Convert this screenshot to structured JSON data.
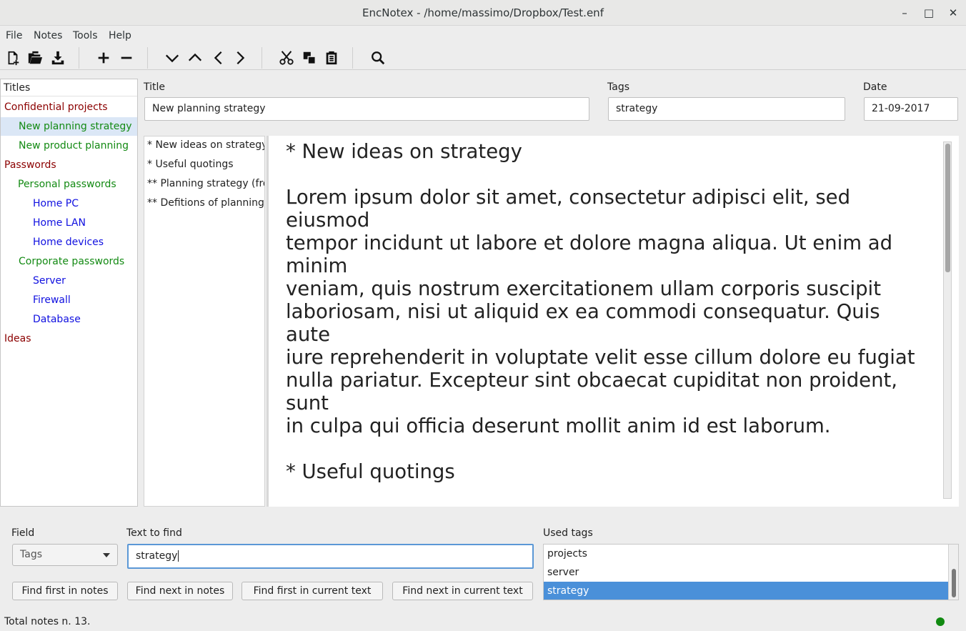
{
  "window": {
    "title": "EncNotex - /home/massimo/Dropbox/Test.enf",
    "minimize": "–",
    "maximize": "□",
    "close": "✕"
  },
  "menu": [
    "File",
    "Notes",
    "Tools",
    "Help"
  ],
  "toolbar": {
    "icons": [
      "new-file-icon",
      "open-file-icon",
      "save-file-icon",
      "add-icon",
      "remove-icon",
      "move-down-icon",
      "move-up-icon",
      "move-left-icon",
      "move-right-icon",
      "cut-icon",
      "copy-icon",
      "paste-icon",
      "search-icon"
    ]
  },
  "tree": {
    "header": "Titles",
    "items": [
      {
        "label": "Confidential projects",
        "level": 0,
        "color": "#8b0000"
      },
      {
        "label": "New planning strategy",
        "level": 1,
        "color": "#138a13",
        "selected": true
      },
      {
        "label": "New product planning",
        "level": 1,
        "color": "#138a13"
      },
      {
        "label": "Passwords",
        "level": 0,
        "color": "#8b0000"
      },
      {
        "label": "Personal passwords",
        "level": 1,
        "color": "#138a13"
      },
      {
        "label": "Home PC",
        "level": 2,
        "color": "#1010e0"
      },
      {
        "label": "Home LAN",
        "level": 2,
        "color": "#1010e0"
      },
      {
        "label": "Home devices",
        "level": 2,
        "color": "#1010e0"
      },
      {
        "label": "Corporate passwords",
        "level": 1,
        "color": "#138a13"
      },
      {
        "label": "Server",
        "level": 2,
        "color": "#1010e0"
      },
      {
        "label": "Firewall",
        "level": 2,
        "color": "#1010e0"
      },
      {
        "label": "Database",
        "level": 2,
        "color": "#1010e0"
      },
      {
        "label": "Ideas",
        "level": 0,
        "color": "#8b0000"
      }
    ]
  },
  "note": {
    "title_label": "Title",
    "title_value": "New planning strategy",
    "tags_label": "Tags",
    "tags_value": "strategy",
    "date_label": "Date",
    "date_value": "21-09-2017"
  },
  "outline": [
    "* New ideas on strategy",
    "* Useful quotings",
    "** Planning strategy (from Wikipedia)",
    "** Defitions of planning strategy"
  ],
  "editor": {
    "text": "* New ideas on strategy\n\nLorem ipsum dolor sit amet, consectetur adipisci elit, sed eiusmod\ntempor incidunt ut labore et dolore magna aliqua. Ut enim ad minim\nveniam, quis nostrum exercitationem ullam corporis suscipit\nlaboriosam, nisi ut aliquid ex ea commodi consequatur. Quis aute\niure reprehenderit in voluptate velit esse cillum dolore eu fugiat\nnulla pariatur. Excepteur sint obcaecat cupiditat non proident, sunt\nin culpa qui officia deserunt mollit anim id est laborum.\n\n* Useful quotings\n\n** Planning strategy (from Wikipedia)\n\nStrategic planning is an organization's process of defining its strategy,\nor direction, and making decisions on allocating its resources to"
  },
  "search": {
    "field_label": "Field",
    "field_value": "Tags",
    "text_label": "Text to find",
    "text_value": "strategy",
    "used_tags_label": "Used tags",
    "buttons": [
      "Find first in notes",
      "Find next in notes",
      "Find first in current text",
      "Find next in current text"
    ],
    "used_tags": [
      {
        "label": "projects",
        "selected": false
      },
      {
        "label": "server",
        "selected": false
      },
      {
        "label": "strategy",
        "selected": true
      }
    ]
  },
  "status": {
    "text": "Total notes n. 13.",
    "indicator_color": "#118a11"
  }
}
